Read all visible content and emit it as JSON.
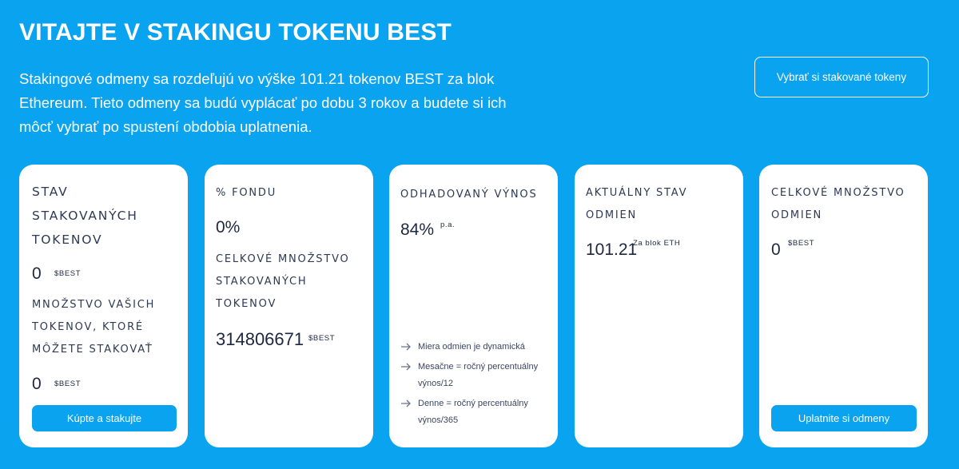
{
  "header": {
    "title": "VITAJTE V STAKINGU TOKENU BEST",
    "intro": "Stakingové odmeny sa rozdeľujú vo výške 101.21 tokenov BEST za blok Ethereum. Tieto odmeny sa budú vyplácať po dobu 3 rokov a budete si ich môcť vybrať po spustení obdobia uplatnenia.",
    "withdraw_label": "Vybrať si stakované tokeny"
  },
  "cards": {
    "staked": {
      "label": "STAV STAKOVANÝCH TOKENOV",
      "value": "0",
      "unit": "$BEST",
      "available_label": "MNOŽSTVO VAŠICH TOKENOV, KTORÉ MÔŽETE STAKOVAŤ",
      "available_value": "0",
      "available_unit": "$BEST",
      "button_label": "Kúpte a stakujte"
    },
    "fund": {
      "label": "% FONDU",
      "value": "0%",
      "total_label": "CELKOVÉ MNOŽSTVO STAKOVANÝCH TOKENOV",
      "total_value": "314806671",
      "total_unit": "$BEST"
    },
    "yield": {
      "label": "ODHADOVANÝ VÝNOS",
      "value": "84%",
      "unit": "p.a.",
      "notes": [
        "Miera odmien je dynamická",
        "Mesačne = ročný percentuálny výnos/12",
        "Denne = ročný percentuálny výnos/365"
      ]
    },
    "current": {
      "label": "AKTUÁLNY STAV ODMIEN",
      "value": "101.21",
      "unit": "Za blok ETH"
    },
    "total": {
      "label": "CELKOVÉ MNOŽSTVO ODMIEN",
      "value": "0",
      "unit": "$BEST",
      "button_label": "Uplatnite si odmeny"
    }
  },
  "colors": {
    "background": "#0aa3f0",
    "card": "#ffffff",
    "text_dark": "#1e2740",
    "button": "#0aa3f0"
  },
  "icons": {
    "note_bullet": "arrow-right-icon"
  }
}
